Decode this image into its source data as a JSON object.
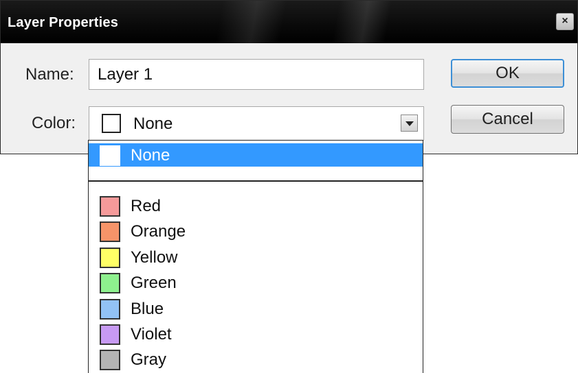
{
  "window": {
    "title": "Layer Properties",
    "close_glyph": "×"
  },
  "form": {
    "name_label": "Name:",
    "name_value": "Layer 1",
    "color_label": "Color:",
    "color_value": "None",
    "color_value_swatch": "#ffffff"
  },
  "buttons": {
    "ok_label": "OK",
    "cancel_label": "Cancel"
  },
  "dropdown": {
    "selected": "None",
    "items": [
      {
        "label": "None",
        "color": "#ffffff",
        "selected": true
      },
      {
        "label": "Red",
        "color": "#f59a9a"
      },
      {
        "label": "Orange",
        "color": "#f69469"
      },
      {
        "label": "Yellow",
        "color": "#ffff66"
      },
      {
        "label": "Green",
        "color": "#8ef08e"
      },
      {
        "label": "Blue",
        "color": "#92c2f5"
      },
      {
        "label": "Violet",
        "color": "#c79af3"
      },
      {
        "label": "Gray",
        "color": "#b4b4b4"
      }
    ]
  },
  "colors": {
    "highlight": "#3399ff",
    "dialog_bg": "#f0f0f0",
    "titlebar": "#000000",
    "ok_border": "#3c8fd6"
  },
  "icons": {
    "close": "close-icon",
    "dropdown_arrow": "chevron-down-icon"
  }
}
